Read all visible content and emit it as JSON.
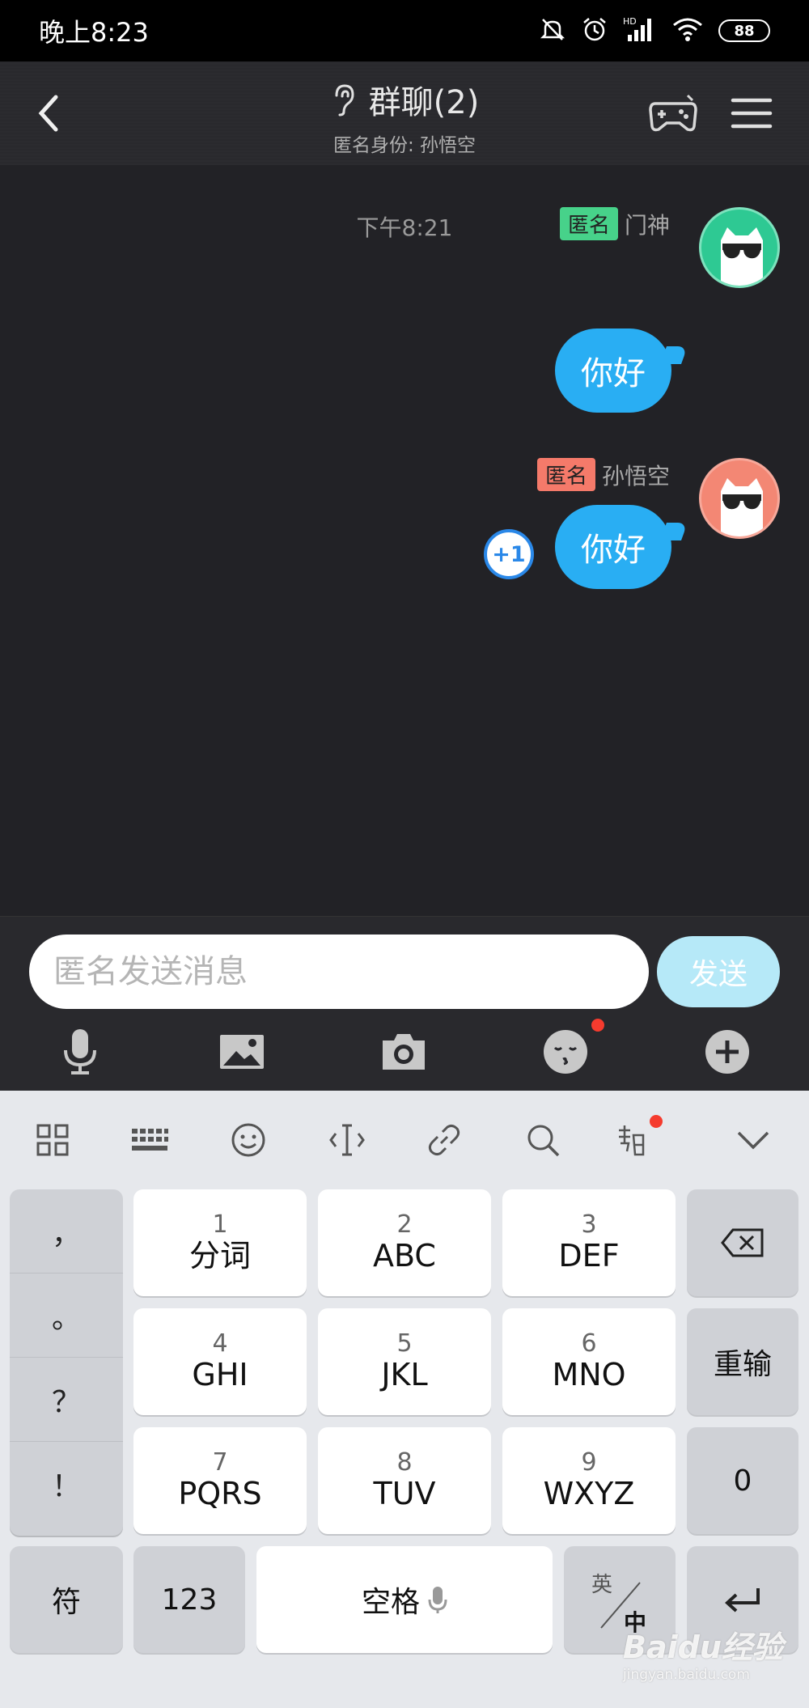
{
  "status_bar": {
    "time": "晚上8:23",
    "battery": "88",
    "network_label": "HD"
  },
  "nav": {
    "title": "群聊(2)",
    "subtitle": "匿名身份: 孙悟空"
  },
  "chat": {
    "timestamp": "下午8:21",
    "messages": [
      {
        "badge": "匿名",
        "sender": "门神",
        "text": "你好",
        "badge_color": "#47d28a",
        "avatar_color": "#2ec993"
      },
      {
        "badge": "匿名",
        "sender": "孙悟空",
        "text": "你好",
        "badge_color": "#f57a6a",
        "avatar_color": "#f38774"
      }
    ],
    "plus_one": "+1"
  },
  "input": {
    "placeholder": "匿名发送消息",
    "send_label": "发送"
  },
  "keyboard": {
    "punctuation": [
      "，",
      "。",
      "？",
      "！"
    ],
    "keys": [
      {
        "num": "1",
        "letters": "分词"
      },
      {
        "num": "2",
        "letters": "ABC"
      },
      {
        "num": "3",
        "letters": "DEF"
      },
      {
        "num": "4",
        "letters": "GHI"
      },
      {
        "num": "5",
        "letters": "JKL"
      },
      {
        "num": "6",
        "letters": "MNO"
      },
      {
        "num": "7",
        "letters": "PQRS"
      },
      {
        "num": "8",
        "letters": "TUV"
      },
      {
        "num": "9",
        "letters": "WXYZ"
      }
    ],
    "retype_label": "重输",
    "zero_label": "0",
    "symbol_label": "符",
    "num_label": "123",
    "space_label": "空格",
    "lang_top": "英",
    "lang_bottom": "中"
  },
  "watermark": {
    "brand": "Baidu经验",
    "url": "jingyan.baidu.com"
  },
  "colors": {
    "bubble": "#29aef3",
    "send_button": "#b6e9f8",
    "accent_blue": "#2a88e8"
  }
}
